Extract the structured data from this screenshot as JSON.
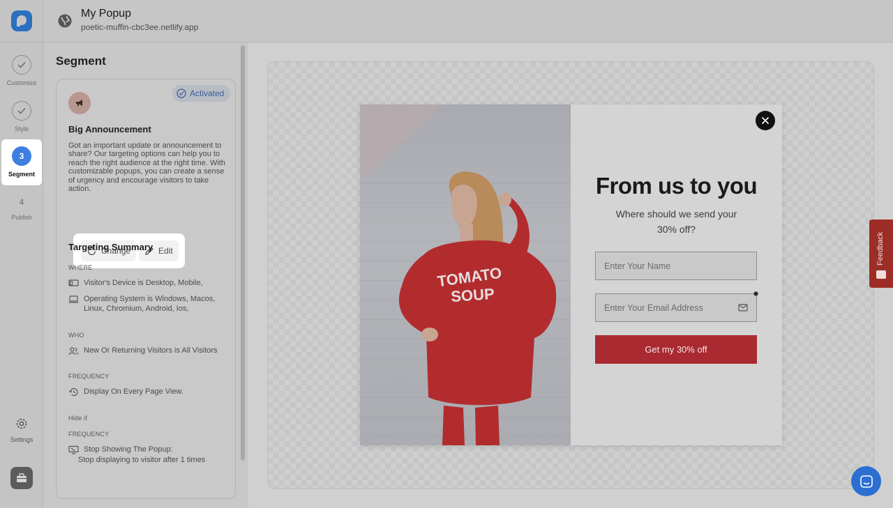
{
  "colors": {
    "accent": "#3d7fe0",
    "cta": "#a92a30",
    "feedback": "#9c2d27",
    "chat": "#2a6fd1"
  },
  "rail": {
    "steps": [
      {
        "label": "Customize",
        "state": "done"
      },
      {
        "label": "Style",
        "state": "done"
      },
      {
        "label": "Segment",
        "number": "3",
        "state": "active"
      },
      {
        "label": "Publish",
        "number": "4",
        "state": "pending"
      }
    ],
    "settings_label": "Settings"
  },
  "header": {
    "title": "My Popup",
    "subtitle": "poetic-muffin-cbc3ee.netlify.app"
  },
  "panel": {
    "title": "Segment",
    "card": {
      "badge": "Activated",
      "heading": "Big Announcement",
      "description": "Got an important update or announcement to share? Our targeting options can help you to reach the right audience at the right time. With customizable popups, you can create a sense of urgency and encourage visitors to take action.",
      "change_label": "Change",
      "edit_label": "Edit"
    },
    "summary": {
      "title": "Targeting Summary",
      "where_label": "WHERE",
      "device": "Visitor's Device is Desktop, Mobile,",
      "os": "Operating System is Windows, Macos, Linux, Chromium, Android, Ios,",
      "who_label": "WHO",
      "visitors": "New Or Returning Visitors is All Visitors",
      "frequency_label": "FREQUENCY",
      "display": "Display On Every Page View.",
      "hide_if_label": "Hide if",
      "hide_frequency_label": "FREQUENCY",
      "stop_line1": "Stop Showing The Popup:",
      "stop_line2": "Stop displaying to visitor after 1 times"
    }
  },
  "popup": {
    "headline": "From us to you",
    "subtext": "Where should we send your 30% off?",
    "name_placeholder": "Enter Your Name",
    "email_placeholder": "Enter Your Email Address",
    "cta_label": "Get my 30% off",
    "shirt_line1": "TOMATO",
    "shirt_line2": "SOUP"
  },
  "feedback_label": "Feedback"
}
